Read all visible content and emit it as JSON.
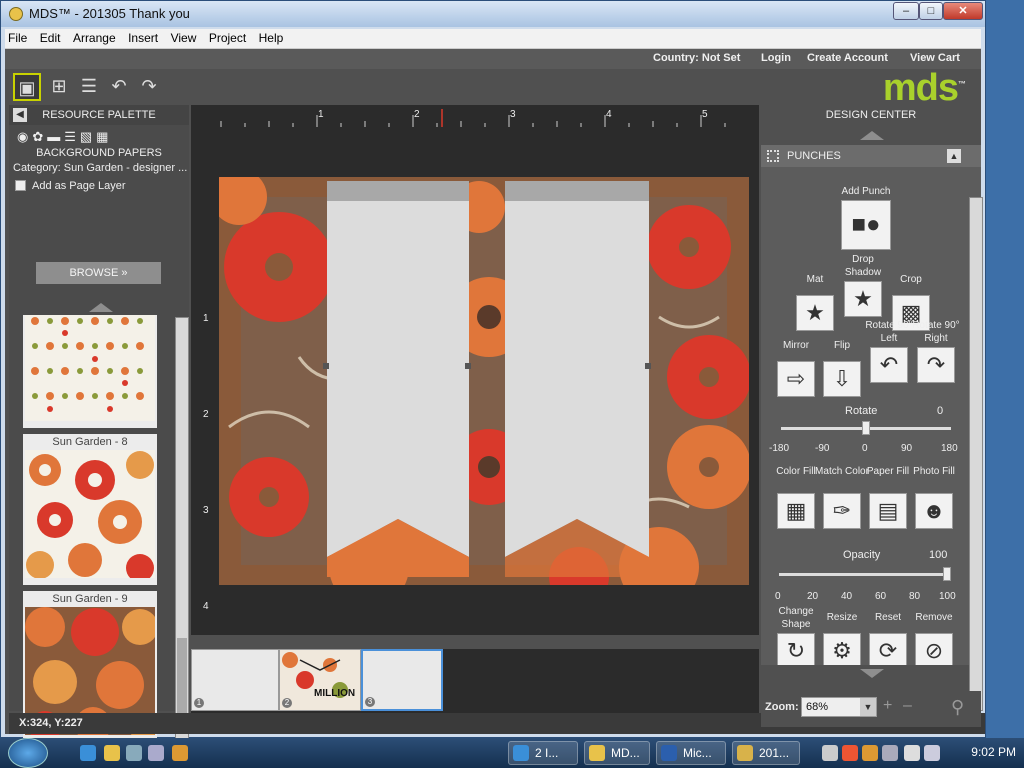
{
  "window": {
    "title": "MDS™ - 201305 Thank you",
    "minimize": "–",
    "maximize": "□",
    "close": "✕"
  },
  "menu": [
    "File",
    "Edit",
    "Arrange",
    "Insert",
    "View",
    "Project",
    "Help"
  ],
  "topnav": {
    "country": "Country: Not Set",
    "login": "Login",
    "create_account": "Create Account",
    "view_cart": "View Cart"
  },
  "logo": {
    "text": "mds",
    "tm": "™",
    "color": "#a9d12c"
  },
  "palette": {
    "header": "RESOURCE PALETTE",
    "section_title": "BACKGROUND PAPERS",
    "category": "Category: Sun Garden - designer ...",
    "add_layer": "Add as Page Layer",
    "browse": "BROWSE",
    "thumbs": [
      {
        "label": ""
      },
      {
        "label": "Sun Garden - 8"
      },
      {
        "label": "Sun Garden - 9"
      }
    ]
  },
  "ruler": {
    "top": [
      "1",
      "2",
      "3",
      "4",
      "5"
    ],
    "left": [
      "1",
      "2",
      "3",
      "4"
    ]
  },
  "design_center": {
    "header": "DESIGN CENTER",
    "panel_title": "PUNCHES",
    "add_punch": "Add Punch",
    "mat": "Mat",
    "drop_shadow": "Drop Shadow",
    "crop": "Crop",
    "mirror": "Mirror",
    "flip": "Flip",
    "rotate_left": "Rotate 90° Left",
    "rotate_right": "Rotate 90° Right",
    "rotate_label": "Rotate",
    "rotate_value": "0",
    "rotate_ticks": [
      "-180",
      "-90",
      "0",
      "90",
      "180"
    ],
    "rotate_fraction": 0.5,
    "color_fill": "Color Fill",
    "match_color": "Match Color",
    "paper_fill": "Paper Fill",
    "photo_fill": "Photo Fill",
    "opacity_label": "Opacity",
    "opacity_value": "100",
    "opacity_ticks": [
      "0",
      "20",
      "40",
      "60",
      "80",
      "100"
    ],
    "opacity_fraction": 1.0,
    "change_shape": "Change Shape",
    "resize": "Resize",
    "reset": "Reset",
    "remove": "Remove"
  },
  "zoom": {
    "label": "Zoom:",
    "value": "68%",
    "plus": "+",
    "minus": "–"
  },
  "pages": [
    {
      "num": "1"
    },
    {
      "num": "2",
      "text": "MILLION"
    },
    {
      "num": "3"
    }
  ],
  "status": {
    "coords": "X:324, Y:227"
  },
  "taskbar": {
    "tasks": [
      {
        "label": "2 I...",
        "color": "#3a8fd8"
      },
      {
        "label": "MD...",
        "color": "#e8c24a"
      },
      {
        "label": "Mic...",
        "color": "#2b5fad"
      },
      {
        "label": "201...",
        "color": "#d8b24a"
      }
    ],
    "clock": "9:02 PM"
  },
  "colors": {
    "accent": "#a9d12c",
    "panel": "#5c5c5c",
    "workspace": "#2b2b2b",
    "paper_brown": "#8a5a3a",
    "flower_red": "#d9392b",
    "flower_orange": "#e0763a",
    "banner": "#dcdcdc"
  }
}
